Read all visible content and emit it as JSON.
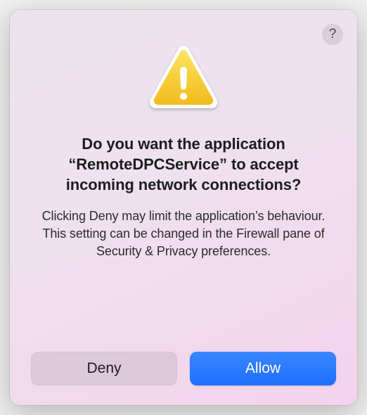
{
  "dialog": {
    "help_label": "?",
    "heading": "Do you want the application “RemoteDPCService” to accept incoming network connections?",
    "subtext": "Clicking Deny may limit the application’s behaviour. This setting can be changed in the Firewall pane of Security & Privacy preferences.",
    "deny_label": "Deny",
    "allow_label": "Allow"
  }
}
